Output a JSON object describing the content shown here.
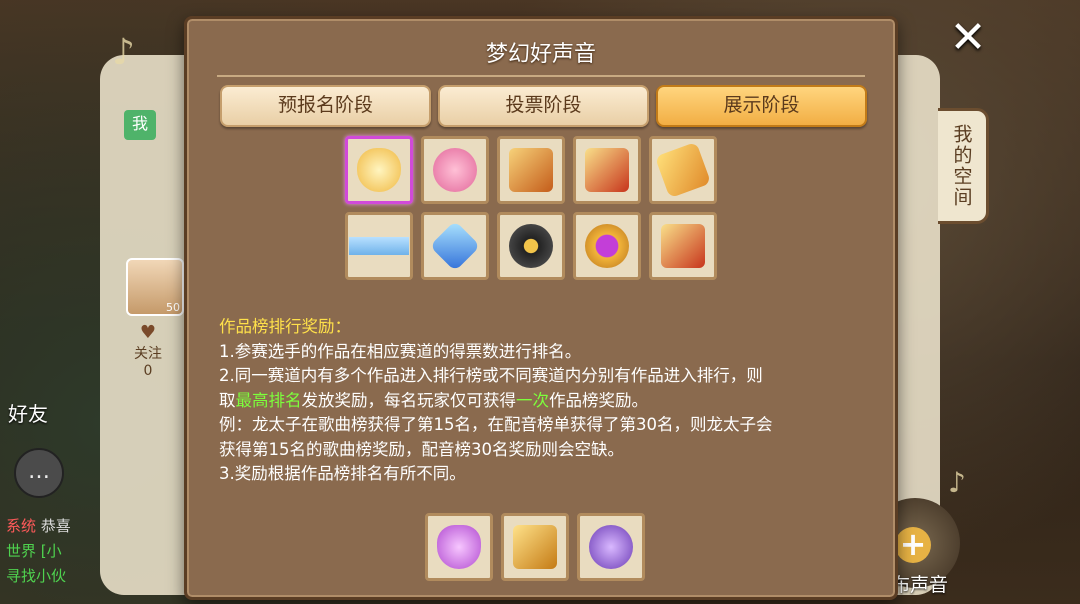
{
  "dialog": {
    "title": "梦幻好声音",
    "tabs": [
      {
        "label": "预报名阶段",
        "active": false
      },
      {
        "label": "投票阶段",
        "active": false
      },
      {
        "label": "展示阶段",
        "active": true
      }
    ],
    "items": [
      {
        "icon": "golden-egg-icon",
        "selected": true
      },
      {
        "icon": "pink-pig-icon"
      },
      {
        "icon": "scroll-icon"
      },
      {
        "icon": "red-scroll-icon"
      },
      {
        "icon": "microphone-frame-icon"
      },
      {
        "icon": "blue-bar-icon"
      },
      {
        "icon": "crystal-gem-icon"
      },
      {
        "icon": "vinyl-record-icon"
      },
      {
        "icon": "gold-music-emblem-icon"
      },
      {
        "icon": "red-scroll-icon"
      }
    ],
    "rules": {
      "heading": "作品榜排行奖励：",
      "line1": "1.参赛选手的作品在相应赛道的得票数进行排名。",
      "line2_a": "2.同一赛道内有多个作品进入排行榜或不同赛道内分别有作品进入排行，则",
      "line2_b1": "取",
      "line2_hl1": "最高排名",
      "line2_b2": "发放奖励，每名玩家仅可获得",
      "line2_hl2": "一次",
      "line2_b3": "作品榜奖励。",
      "example_a": "例：龙太子在歌曲榜获得了第15名，在配音榜单获得了第30名，则龙太子会",
      "example_b": "获得第15名的歌曲榜奖励，配音榜30名奖励则会空缺。",
      "line3": "3.奖励根据作品榜排名有所不同。"
    },
    "rewards": [
      {
        "icon": "potion-bottle-icon"
      },
      {
        "icon": "golden-hammer-icon"
      },
      {
        "icon": "purple-pouch-icon"
      }
    ]
  },
  "background": {
    "me_badge": "我",
    "my_space": "我的空间",
    "follow_label": "关注",
    "follow_count": "0",
    "avatar_level": "50",
    "friends_label": "好友",
    "publish_label": "发布声音",
    "chat": [
      {
        "tag": "系统",
        "text": "恭喜"
      },
      {
        "tag": "世界",
        "text": "[小"
      },
      {
        "tag": "",
        "text": "寻找小伙"
      }
    ]
  },
  "colors": {
    "highlight_green": "#7dff3c",
    "heading_yellow": "#ffe14a",
    "tab_active": "#f2ae44",
    "selected_border": "#d14ad9"
  }
}
